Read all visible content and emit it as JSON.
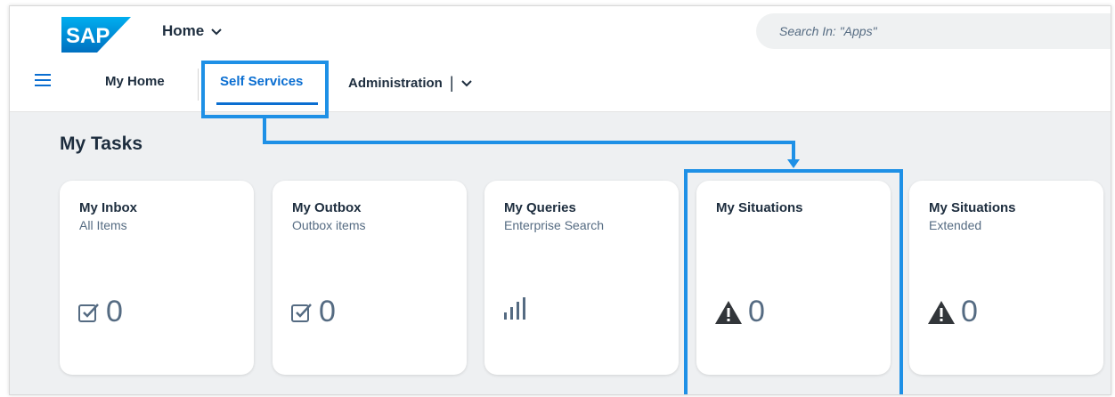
{
  "header": {
    "logo_text": "SAP",
    "app_title": "Home",
    "search_placeholder": "Search In: \"Apps\""
  },
  "nav": {
    "tabs": [
      {
        "label": "My Home"
      },
      {
        "label": "Self Services"
      },
      {
        "label": "Administration"
      }
    ],
    "separator": "|"
  },
  "main": {
    "section_title": "My Tasks",
    "tiles": [
      {
        "title": "My Inbox",
        "subtitle": "All Items",
        "value": "0",
        "icon": "checkbox-icon"
      },
      {
        "title": "My Outbox",
        "subtitle": "Outbox items",
        "value": "0",
        "icon": "checkbox-icon"
      },
      {
        "title": "My Queries",
        "subtitle": "Enterprise Search",
        "value": "",
        "icon": "bar-chart-icon"
      },
      {
        "title": "My Situations",
        "subtitle": "",
        "value": "0",
        "icon": "warning-icon"
      },
      {
        "title": "My Situations",
        "subtitle": "Extended",
        "value": "0",
        "icon": "warning-icon"
      }
    ]
  },
  "colors": {
    "accent": "#0a6ed1",
    "highlight": "#1e90e6",
    "text": "#1d2d3e",
    "subtext": "#556b82"
  }
}
